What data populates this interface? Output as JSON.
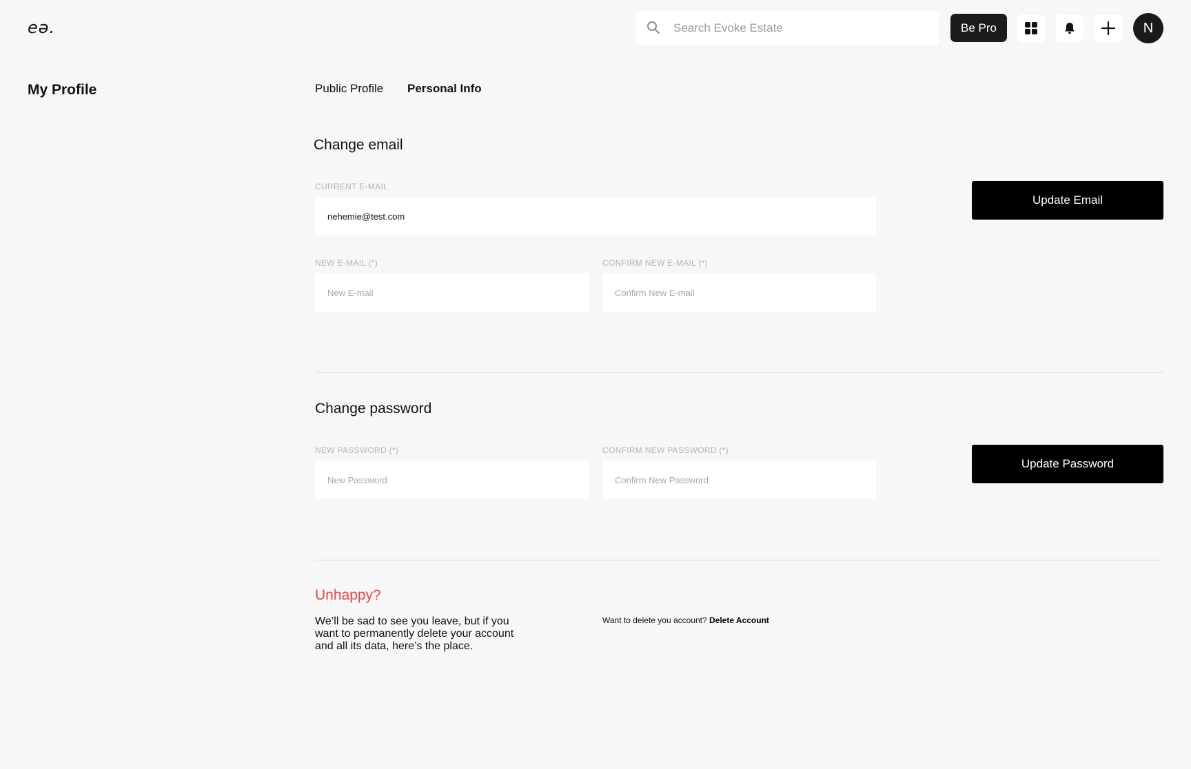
{
  "header": {
    "logo": "eə.",
    "search_placeholder": "Search Evoke Estate",
    "be_pro_label": "Be Pro",
    "avatar_initial": "N"
  },
  "sidebar": {
    "title": "My Profile"
  },
  "tabs": [
    {
      "label": "Public Profile",
      "active": false
    },
    {
      "label": "Personal Info",
      "active": true
    }
  ],
  "email_section": {
    "title": "Change email",
    "current_label": "CURRENT E-MAIL",
    "current_value": "nehemie@test.com",
    "new_label": "NEW E-MAIL (*)",
    "new_placeholder": "New E-mail",
    "confirm_label": "CONFIRM NEW E-MAIL (*)",
    "confirm_placeholder": "Confirm New E-mail",
    "button_label": "Update Email"
  },
  "password_section": {
    "title": "Change password",
    "new_label": "NEW PASSWORD (*)",
    "new_placeholder": "New Password",
    "confirm_label": "CONFIRM NEW PASSWORD (*)",
    "confirm_placeholder": "Confirm New Password",
    "button_label": "Update Password"
  },
  "delete_section": {
    "title": "Unhappy?",
    "description": "We’ll be sad to see you leave, but if you want to permanently delete your account and all its data, here’s the place.",
    "prompt": "Want to delete you account?",
    "link_label": "Delete Account"
  },
  "colors": {
    "background": "#f7f7f7",
    "accent_red": "#e74444",
    "button_black": "#000000"
  }
}
